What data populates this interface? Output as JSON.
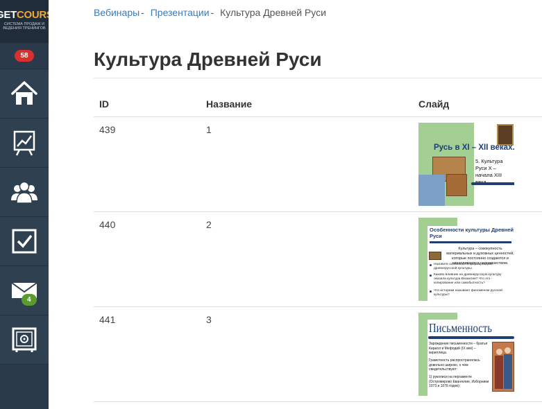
{
  "logo": {
    "part1": "GET",
    "part2": "COURSE",
    "subtitle": "СИСТЕМА ПРОДАЖ И ВЕДЕНИЯ ТРЕНИНГОВ"
  },
  "sidebar": {
    "notifications_count": "58",
    "items": [
      {
        "icon": "home-icon"
      },
      {
        "icon": "chart-icon"
      },
      {
        "icon": "users-icon"
      },
      {
        "icon": "checkbox-icon"
      },
      {
        "icon": "mail-icon",
        "badge": "4"
      },
      {
        "icon": "safe-icon"
      }
    ]
  },
  "breadcrumb": {
    "items": [
      "Вебинары",
      "Презентации"
    ],
    "current": "Культура Древней Руси"
  },
  "page": {
    "title": "Культура Древней Руси"
  },
  "table": {
    "headers": {
      "id": "ID",
      "name": "Название",
      "slide": "Слайд"
    },
    "rows": [
      {
        "id": "439",
        "name": "1",
        "slide": {
          "title": "Русь в XI – XII веках.",
          "text": "5. Культура Руси X – начала XIII века."
        }
      },
      {
        "id": "440",
        "name": "2",
        "slide": {
          "title": "Особенности культуры Древней Руси",
          "text": "Культура – совокупность материальных и духовных ценностей, которые постоянно создаются и накапливаются человечеством.",
          "bullets": [
            "Назовите особенности формирования древнерусской культуры.",
            "Каково влияние на древнерусскую культуру оказала культура Византии? Что это - копирование или самобытность?",
            "Что историки называют феноменом русской культуры?"
          ]
        }
      },
      {
        "id": "441",
        "name": "3",
        "slide": {
          "title": "Письменность",
          "text1": "Зарождение письменности – братья Кирилл и Мефодий (IX век) – кириллица.",
          "text2": "Грамотность распространялась довольно широко, о чем свидетельствуют:",
          "text3": "1) рукописи на пергаменте (Остромирово Евангелие, Изборники 1073 и 1076 годов);"
        }
      }
    ]
  },
  "colors": {
    "sidebar": "#2a3a4a",
    "link": "#3a7bbf",
    "slide_green": "#a3cf94",
    "slide_blue": "#1e3e74"
  }
}
